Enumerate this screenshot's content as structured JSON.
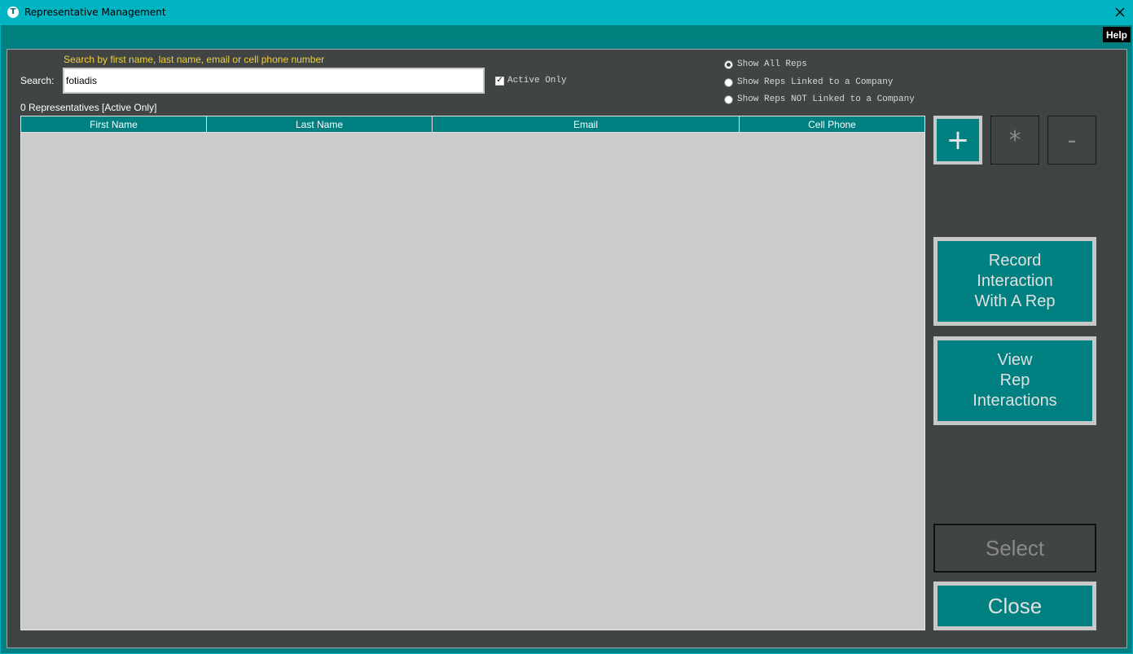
{
  "window": {
    "title": "Representative Management",
    "icon": "app-logo-icon",
    "close_glyph": "✕"
  },
  "menu": {
    "help_label": "Help"
  },
  "search": {
    "hint": "Search by first name, last name, email or cell phone number",
    "label": "Search:",
    "value": "fotiadis",
    "active_only_label": "Active Only",
    "active_only_checked": true
  },
  "filters": {
    "options": [
      {
        "label": "Show All Reps",
        "selected": true
      },
      {
        "label": "Show Reps Linked to a Company",
        "selected": false
      },
      {
        "label": "Show Reps NOT Linked to a Company",
        "selected": false
      }
    ]
  },
  "list": {
    "count_label": "0 Representatives [Active Only]",
    "columns": [
      "First Name",
      "Last Name",
      "Email",
      "Cell Phone"
    ],
    "rows": []
  },
  "actions": {
    "add_label": "+",
    "edit_label": "*",
    "delete_label": "-",
    "record_label": "Record\nInteraction\nWith A Rep",
    "view_label": "View\nRep\nInteractions",
    "select_label": "Select",
    "close_label": "Close"
  },
  "colors": {
    "titlebar": "#00b4c4",
    "accent": "#008080",
    "panel": "#404444",
    "hint": "#f0d040",
    "table_body": "#cbcbcb"
  }
}
